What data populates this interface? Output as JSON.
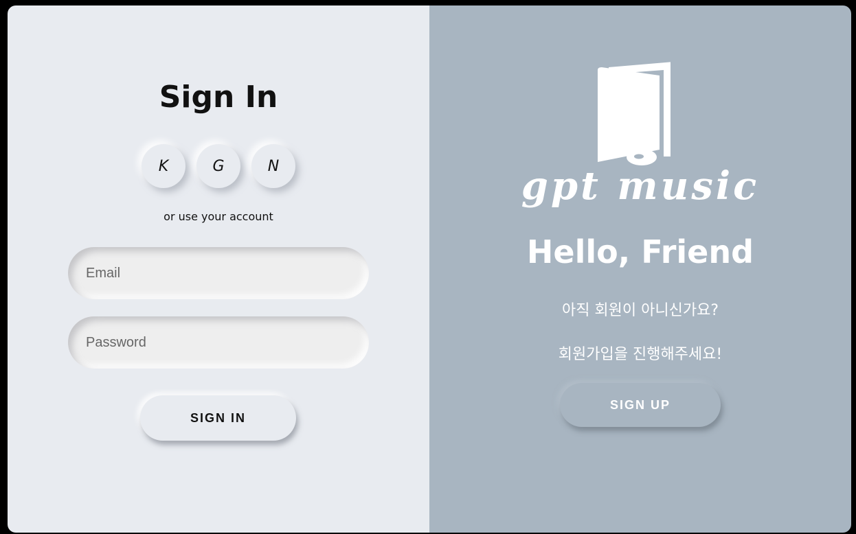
{
  "signin": {
    "title": "Sign In",
    "social": [
      "K",
      "G",
      "N"
    ],
    "alt_text": "or use your account",
    "email_placeholder": "Email",
    "password_placeholder": "Password",
    "button_label": "SIGN IN"
  },
  "signup": {
    "brand": "gpt music",
    "title": "Hello, Friend",
    "line1": "아직 회원이 아니신가요?",
    "line2": "회원가입을 진행해주세요!",
    "button_label": "SIGN UP"
  },
  "colors": {
    "left_bg": "#e8ebf0",
    "right_bg": "#a8b5c1",
    "text_dark": "#111111",
    "text_light": "#ffffff"
  },
  "icons": {
    "logo": "book-disc-logo-icon"
  }
}
